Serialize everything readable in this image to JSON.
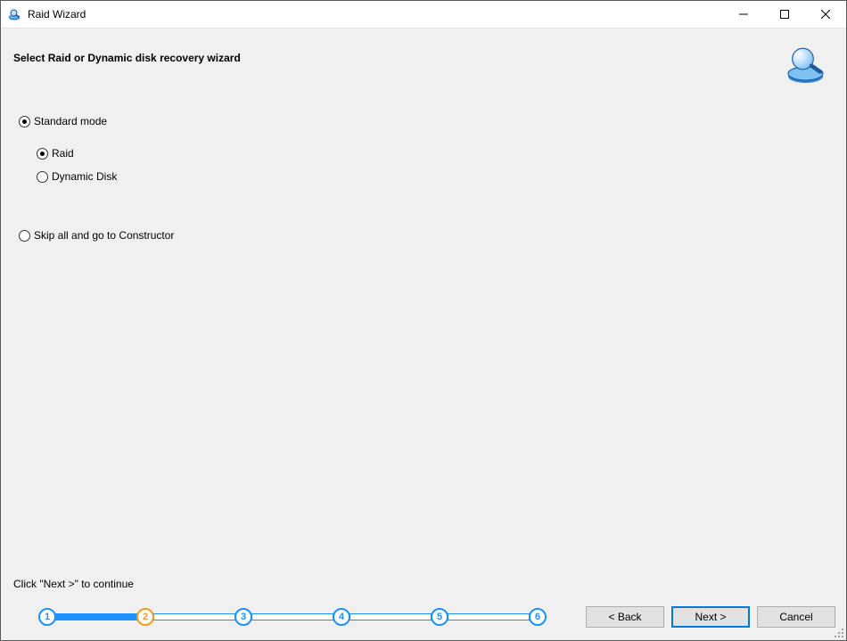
{
  "window": {
    "title": "Raid Wizard"
  },
  "header": {
    "title": "Select Raid or Dynamic disk recovery wizard"
  },
  "options": {
    "standard_mode": {
      "label": "Standard mode",
      "checked": true
    },
    "raid": {
      "label": "Raid",
      "checked": true
    },
    "dynamic_disk": {
      "label": "Dynamic Disk",
      "checked": false
    },
    "skip": {
      "label": "Skip all and go to Constructor",
      "checked": false
    }
  },
  "footer": {
    "hint": "Click \"Next >\" to continue",
    "steps": [
      "1",
      "2",
      "3",
      "4",
      "5",
      "6"
    ],
    "current_step": 2,
    "buttons": {
      "back": "< Back",
      "next": "Next >",
      "cancel": "Cancel"
    }
  }
}
